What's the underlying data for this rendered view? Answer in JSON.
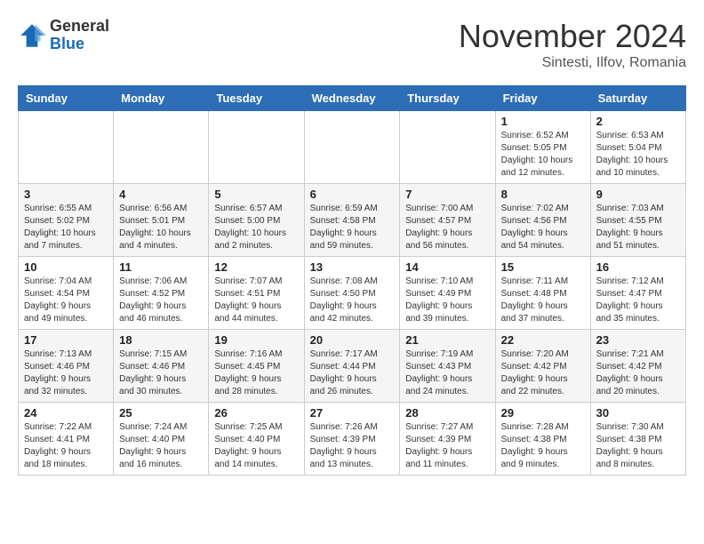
{
  "logo": {
    "general": "General",
    "blue": "Blue"
  },
  "title": "November 2024",
  "subtitle": "Sintesti, Ilfov, Romania",
  "days_header": [
    "Sunday",
    "Monday",
    "Tuesday",
    "Wednesday",
    "Thursday",
    "Friday",
    "Saturday"
  ],
  "weeks": [
    [
      {
        "day": "",
        "info": ""
      },
      {
        "day": "",
        "info": ""
      },
      {
        "day": "",
        "info": ""
      },
      {
        "day": "",
        "info": ""
      },
      {
        "day": "",
        "info": ""
      },
      {
        "day": "1",
        "info": "Sunrise: 6:52 AM\nSunset: 5:05 PM\nDaylight: 10 hours\nand 12 minutes."
      },
      {
        "day": "2",
        "info": "Sunrise: 6:53 AM\nSunset: 5:04 PM\nDaylight: 10 hours\nand 10 minutes."
      }
    ],
    [
      {
        "day": "3",
        "info": "Sunrise: 6:55 AM\nSunset: 5:02 PM\nDaylight: 10 hours\nand 7 minutes."
      },
      {
        "day": "4",
        "info": "Sunrise: 6:56 AM\nSunset: 5:01 PM\nDaylight: 10 hours\nand 4 minutes."
      },
      {
        "day": "5",
        "info": "Sunrise: 6:57 AM\nSunset: 5:00 PM\nDaylight: 10 hours\nand 2 minutes."
      },
      {
        "day": "6",
        "info": "Sunrise: 6:59 AM\nSunset: 4:58 PM\nDaylight: 9 hours\nand 59 minutes."
      },
      {
        "day": "7",
        "info": "Sunrise: 7:00 AM\nSunset: 4:57 PM\nDaylight: 9 hours\nand 56 minutes."
      },
      {
        "day": "8",
        "info": "Sunrise: 7:02 AM\nSunset: 4:56 PM\nDaylight: 9 hours\nand 54 minutes."
      },
      {
        "day": "9",
        "info": "Sunrise: 7:03 AM\nSunset: 4:55 PM\nDaylight: 9 hours\nand 51 minutes."
      }
    ],
    [
      {
        "day": "10",
        "info": "Sunrise: 7:04 AM\nSunset: 4:54 PM\nDaylight: 9 hours\nand 49 minutes."
      },
      {
        "day": "11",
        "info": "Sunrise: 7:06 AM\nSunset: 4:52 PM\nDaylight: 9 hours\nand 46 minutes."
      },
      {
        "day": "12",
        "info": "Sunrise: 7:07 AM\nSunset: 4:51 PM\nDaylight: 9 hours\nand 44 minutes."
      },
      {
        "day": "13",
        "info": "Sunrise: 7:08 AM\nSunset: 4:50 PM\nDaylight: 9 hours\nand 42 minutes."
      },
      {
        "day": "14",
        "info": "Sunrise: 7:10 AM\nSunset: 4:49 PM\nDaylight: 9 hours\nand 39 minutes."
      },
      {
        "day": "15",
        "info": "Sunrise: 7:11 AM\nSunset: 4:48 PM\nDaylight: 9 hours\nand 37 minutes."
      },
      {
        "day": "16",
        "info": "Sunrise: 7:12 AM\nSunset: 4:47 PM\nDaylight: 9 hours\nand 35 minutes."
      }
    ],
    [
      {
        "day": "17",
        "info": "Sunrise: 7:13 AM\nSunset: 4:46 PM\nDaylight: 9 hours\nand 32 minutes."
      },
      {
        "day": "18",
        "info": "Sunrise: 7:15 AM\nSunset: 4:46 PM\nDaylight: 9 hours\nand 30 minutes."
      },
      {
        "day": "19",
        "info": "Sunrise: 7:16 AM\nSunset: 4:45 PM\nDaylight: 9 hours\nand 28 minutes."
      },
      {
        "day": "20",
        "info": "Sunrise: 7:17 AM\nSunset: 4:44 PM\nDaylight: 9 hours\nand 26 minutes."
      },
      {
        "day": "21",
        "info": "Sunrise: 7:19 AM\nSunset: 4:43 PM\nDaylight: 9 hours\nand 24 minutes."
      },
      {
        "day": "22",
        "info": "Sunrise: 7:20 AM\nSunset: 4:42 PM\nDaylight: 9 hours\nand 22 minutes."
      },
      {
        "day": "23",
        "info": "Sunrise: 7:21 AM\nSunset: 4:42 PM\nDaylight: 9 hours\nand 20 minutes."
      }
    ],
    [
      {
        "day": "24",
        "info": "Sunrise: 7:22 AM\nSunset: 4:41 PM\nDaylight: 9 hours\nand 18 minutes."
      },
      {
        "day": "25",
        "info": "Sunrise: 7:24 AM\nSunset: 4:40 PM\nDaylight: 9 hours\nand 16 minutes."
      },
      {
        "day": "26",
        "info": "Sunrise: 7:25 AM\nSunset: 4:40 PM\nDaylight: 9 hours\nand 14 minutes."
      },
      {
        "day": "27",
        "info": "Sunrise: 7:26 AM\nSunset: 4:39 PM\nDaylight: 9 hours\nand 13 minutes."
      },
      {
        "day": "28",
        "info": "Sunrise: 7:27 AM\nSunset: 4:39 PM\nDaylight: 9 hours\nand 11 minutes."
      },
      {
        "day": "29",
        "info": "Sunrise: 7:28 AM\nSunset: 4:38 PM\nDaylight: 9 hours\nand 9 minutes."
      },
      {
        "day": "30",
        "info": "Sunrise: 7:30 AM\nSunset: 4:38 PM\nDaylight: 9 hours\nand 8 minutes."
      }
    ]
  ]
}
